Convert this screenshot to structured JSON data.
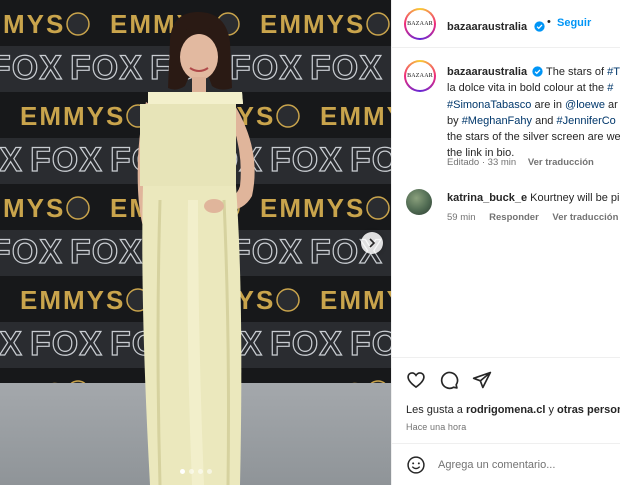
{
  "post": {
    "username": "bazaaraustralia",
    "avatar_text": "BAZAAR",
    "follow_separator": "•",
    "follow_label": "Seguir",
    "caption_lines": [
      [
        {
          "t": "The stars of ",
          "link": false
        },
        {
          "t": "#Th",
          "link": true
        }
      ],
      [
        {
          "t": "la dolce vita in bold colour at the ",
          "link": false
        },
        {
          "t": "#",
          "link": true
        }
      ],
      [
        {
          "t": "#SimonaTabasco",
          "link": true
        },
        {
          "t": " are in ",
          "link": false
        },
        {
          "t": "@loewe",
          "link": true
        },
        {
          "t": " ar",
          "link": false
        }
      ],
      [
        {
          "t": "by ",
          "link": false
        },
        {
          "t": "#MeghanFahy",
          "link": true
        },
        {
          "t": " and ",
          "link": false
        },
        {
          "t": "#JenniferCo",
          "link": true
        }
      ],
      [
        {
          "t": "the stars of the silver screen are we",
          "link": false
        }
      ],
      [
        {
          "t": "the link in bio.",
          "link": false
        }
      ]
    ],
    "edited": "Editado · 33 min",
    "see_translation": "Ver traducción"
  },
  "comment": {
    "username": "katrina_buck_e",
    "text": "Kourtney will be pi",
    "time": "59 min",
    "reply": "Responder",
    "see_translation": "Ver traducción"
  },
  "actions": {
    "likes_prefix": "Les gusta a ",
    "likes_user": "rodrigomena.cl",
    "likes_connector": " y ",
    "likes_others": "otras person",
    "timestamp": "Hace una hora",
    "comment_placeholder": "Agrega un comentario..."
  },
  "media": {
    "backdrop_words": [
      "EMMYS",
      "FOX"
    ],
    "carousel_dots": 4,
    "active_dot": 0
  },
  "colors": {
    "link": "#00376b",
    "follow": "#0095f6",
    "verified": "#0095f6",
    "gold": "#c9a44c",
    "dress": "#eae7bd"
  }
}
